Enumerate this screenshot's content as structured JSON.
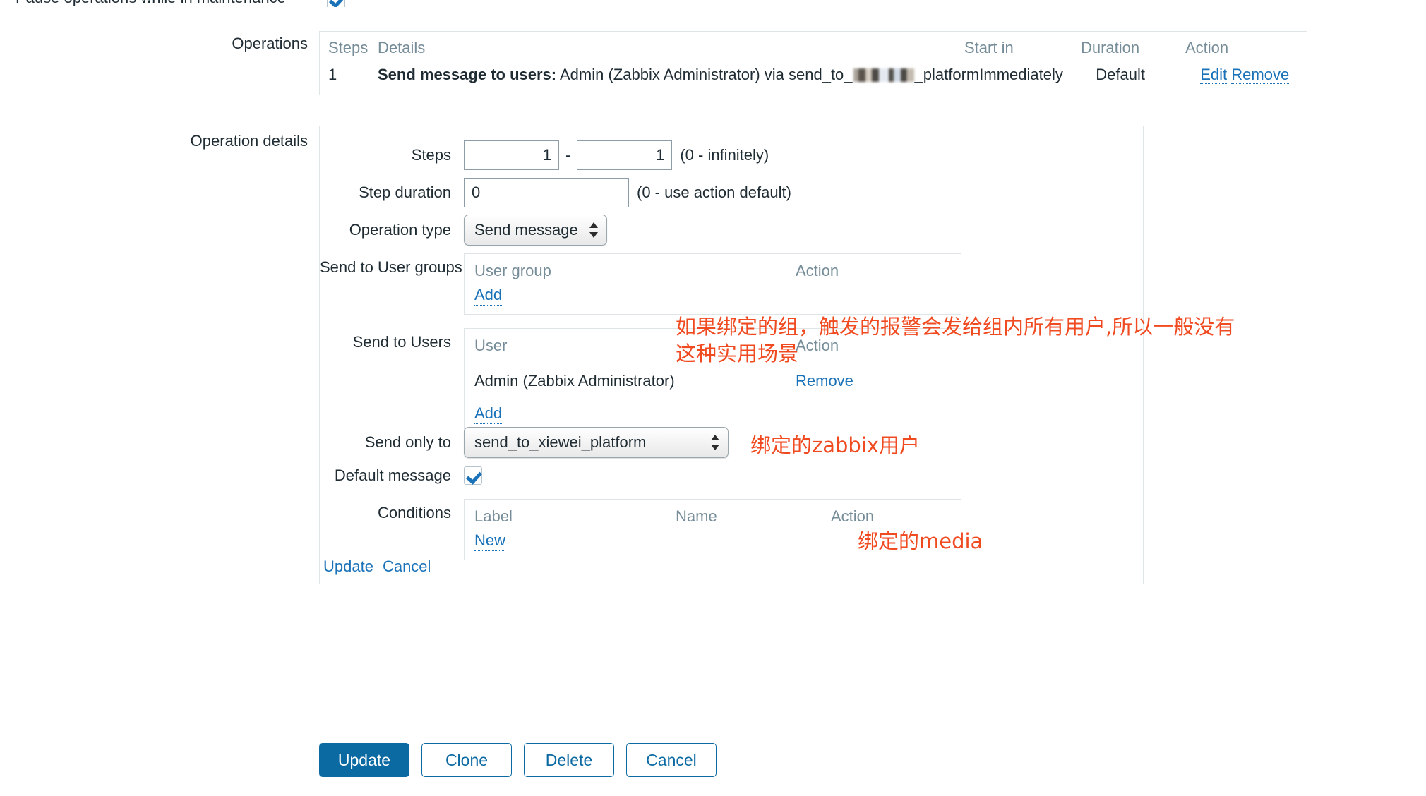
{
  "top_row": {
    "label": "Pause operations while in maintenance",
    "checked": true
  },
  "operations": {
    "label": "Operations",
    "headers": {
      "steps": "Steps",
      "details": "Details",
      "start_in": "Start in",
      "duration": "Duration",
      "action": "Action"
    },
    "rows": [
      {
        "steps": "1",
        "details_bold": "Send message to users:",
        "details_text": " Admin (Zabbix Administrator) via send_to_",
        "details_redacted": true,
        "details_tail": "_platform",
        "start_in": "Immediately",
        "duration": "Default",
        "edit_label": "Edit",
        "remove_label": "Remove"
      }
    ]
  },
  "operation_details": {
    "label": "Operation details",
    "steps": {
      "label": "Steps",
      "from": "1",
      "to": "1",
      "separator": "-",
      "hint": "(0 - infinitely)"
    },
    "step_duration": {
      "label": "Step duration",
      "value": "0",
      "hint": "(0 - use action default)"
    },
    "operation_type": {
      "label": "Operation type",
      "value": "Send message"
    },
    "send_to_user_groups": {
      "label": "Send to User groups",
      "col_group": "User group",
      "col_action": "Action",
      "rows": [],
      "add_label": "Add"
    },
    "send_to_users": {
      "label": "Send to Users",
      "col_user": "User",
      "col_action": "Action",
      "rows": [
        {
          "user": "Admin (Zabbix Administrator)",
          "action": "Remove"
        }
      ],
      "add_label": "Add"
    },
    "send_only_to": {
      "label": "Send only to",
      "value": "send_to_xiewei_platform"
    },
    "default_message": {
      "label": "Default message",
      "checked": true
    },
    "conditions": {
      "label": "Conditions",
      "col_label": "Label",
      "col_name": "Name",
      "col_action": "Action",
      "rows": [],
      "new_label": "New"
    },
    "update_label": "Update",
    "cancel_label": "Cancel"
  },
  "footer_buttons": {
    "update": "Update",
    "clone": "Clone",
    "delete": "Delete",
    "cancel": "Cancel"
  },
  "annotations": [
    {
      "text": "如果绑定的组，触发的报警会发给组内所有用户,所以一般没有\n这种实用场景"
    },
    {
      "text": "绑定的zabbix用户"
    },
    {
      "text": "绑定的media"
    }
  ],
  "colors": {
    "link": "#1a72b8",
    "primary_button": "#0c6aa3",
    "annotation": "#f04a20",
    "muted_header": "#768d99"
  }
}
